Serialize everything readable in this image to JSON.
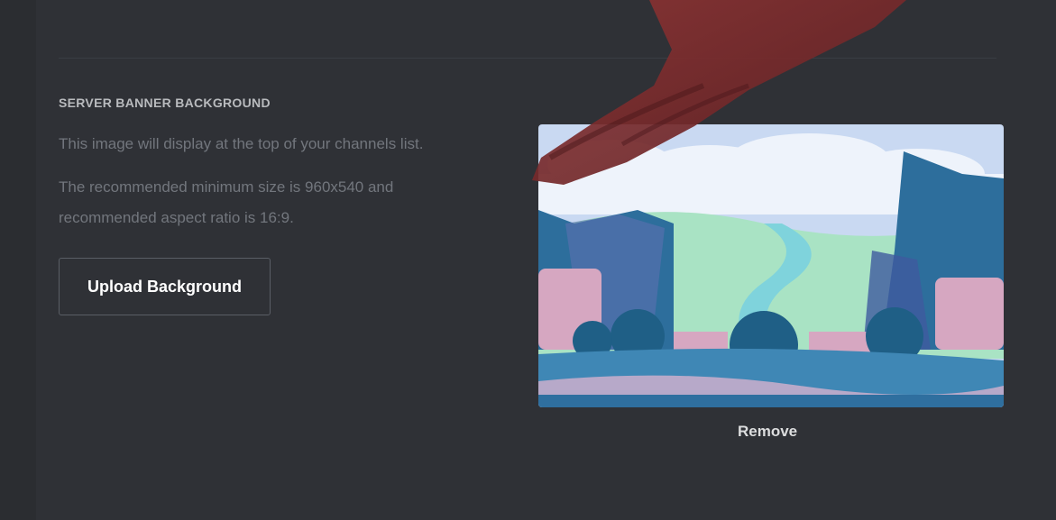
{
  "banner_section": {
    "title": "SERVER BANNER BACKGROUND",
    "description_line1": "This image will display at the top of your channels list.",
    "description_line2": "The recommended minimum size is 960x540 and recommended aspect ratio is 16:9.",
    "upload_button_label": "Upload Background",
    "remove_label": "Remove"
  },
  "banner_image": {
    "subject": "landscape-illustration",
    "palette": {
      "sky": "#c9d9f2",
      "clouds": "#eef3fb",
      "hills": "#a9e3c4",
      "river": "#7fd3dc",
      "cliffs": "#2d6e9c",
      "rocks": "#d6a7c1",
      "trees": "#1f5f86",
      "ground": "#3f87b5"
    }
  },
  "overlay": {
    "hand_color": "#7a2b2b"
  }
}
